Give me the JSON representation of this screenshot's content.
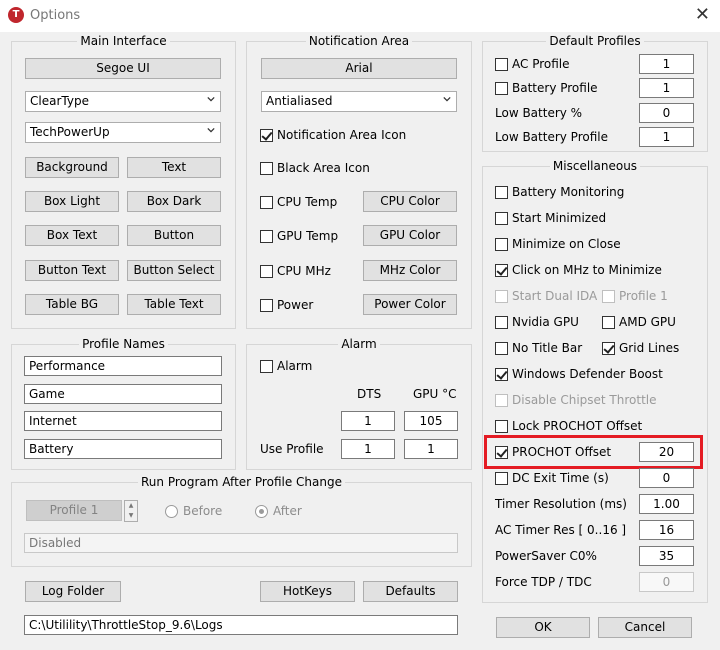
{
  "window": {
    "title": "Options",
    "icon_letter": "T"
  },
  "main_interface": {
    "title": "Main Interface",
    "font_button": "Segoe UI",
    "render_combo": "ClearType",
    "theme_combo": "TechPowerUp",
    "buttons": [
      "Background",
      "Text",
      "Box Light",
      "Box Dark",
      "Box Text",
      "Button",
      "Button Text",
      "Button Select",
      "Table BG",
      "Table Text"
    ]
  },
  "notification_area": {
    "title": "Notification Area",
    "font_button": "Arial",
    "aa_combo": "Antialiased",
    "notification_icon": "Notification Area Icon",
    "black_icon": "Black Area Icon",
    "cpu_temp": "CPU Temp",
    "gpu_temp": "GPU Temp",
    "cpu_mhz": "CPU MHz",
    "power": "Power",
    "cpu_color": "CPU Color",
    "gpu_color": "GPU Color",
    "mhz_color": "MHz Color",
    "power_color": "Power Color"
  },
  "profile_names": {
    "title": "Profile Names",
    "names": [
      "Performance",
      "Game",
      "Internet",
      "Battery"
    ]
  },
  "alarm": {
    "title": "Alarm",
    "alarm_label": "Alarm",
    "dts_header": "DTS",
    "gpu_header": "GPU °C",
    "dts_value": "1",
    "gpu_value": "105",
    "use_profile_label": "Use Profile",
    "use_profile_dts": "1",
    "use_profile_gpu": "1"
  },
  "run_program": {
    "title": "Run Program After Profile Change",
    "profile_button": "Profile 1",
    "before": "Before",
    "after": "After",
    "status": "Disabled"
  },
  "bottom": {
    "log_folder": "Log Folder",
    "hotkeys": "HotKeys",
    "defaults": "Defaults",
    "log_path": "C:\\Utilility\\ThrottleStop_9.6\\Logs"
  },
  "default_profiles": {
    "title": "Default Profiles",
    "ac_profile": "AC Profile",
    "ac_value": "1",
    "battery_profile": "Battery Profile",
    "battery_value": "1",
    "low_battery_pct": "Low Battery %",
    "low_battery_pct_value": "0",
    "low_battery_profile": "Low Battery Profile",
    "low_battery_profile_value": "1"
  },
  "misc": {
    "title": "Miscellaneous",
    "battery_monitoring": "Battery Monitoring",
    "start_minimized": "Start Minimized",
    "minimize_on_close": "Minimize on Close",
    "click_on_mhz": "Click on MHz to Minimize",
    "start_dual_ida": "Start Dual IDA",
    "profile_1": "Profile 1",
    "nvidia_gpu": "Nvidia GPU",
    "amd_gpu": "AMD GPU",
    "no_title_bar": "No Title Bar",
    "grid_lines": "Grid Lines",
    "defender_boost": "Windows Defender Boost",
    "disable_chipset": "Disable Chipset Throttle",
    "lock_prochot": "Lock PROCHOT Offset",
    "prochot_offset": "PROCHOT Offset",
    "prochot_value": "20",
    "dc_exit_time": "DC Exit Time (s)",
    "dc_exit_value": "0",
    "timer_resolution": "Timer Resolution (ms)",
    "timer_resolution_value": "1.00",
    "ac_timer_res": "AC Timer Res [ 0..16 ]",
    "ac_timer_res_value": "16",
    "powersaver": "PowerSaver C0%",
    "powersaver_value": "35",
    "force_tdp": "Force TDP / TDC",
    "force_tdp_value": "0"
  },
  "dialog": {
    "ok": "OK",
    "cancel": "Cancel"
  },
  "colors": {
    "highlight": "#e41b23",
    "app_icon": "#c0262d"
  }
}
